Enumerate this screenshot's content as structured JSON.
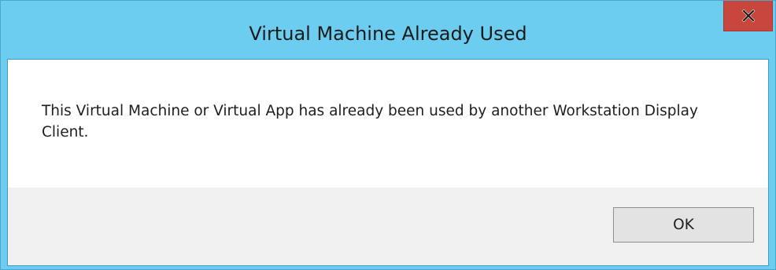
{
  "dialog": {
    "title": "Virtual Machine Already Used",
    "message": "This Virtual Machine or Virtual App has already been used by another Workstation Display Client.",
    "ok_label": "OK",
    "close_icon": "close-icon"
  },
  "colors": {
    "titlebar": "#6ccdf0",
    "close_button": "#c8463d",
    "content_background": "#ffffff",
    "footer_background": "#f0f0f0"
  }
}
